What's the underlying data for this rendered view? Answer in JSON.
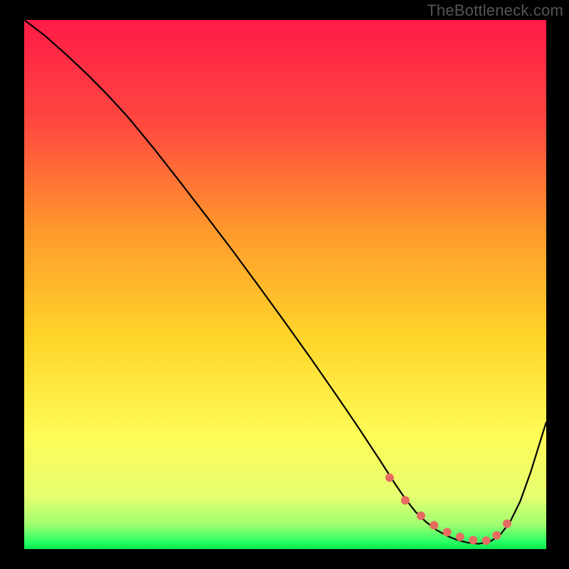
{
  "watermark": "TheBottleneck.com",
  "chart_data": {
    "type": "line",
    "title": "",
    "xlabel": "",
    "ylabel": "",
    "xlim": [
      0,
      100
    ],
    "ylim": [
      0,
      100
    ],
    "grid": false,
    "legend": false,
    "gradient_stops": [
      {
        "offset": 0.0,
        "color": "#ff1b48"
      },
      {
        "offset": 0.2,
        "color": "#ff4a3f"
      },
      {
        "offset": 0.4,
        "color": "#ff9a2c"
      },
      {
        "offset": 0.6,
        "color": "#ffd52a"
      },
      {
        "offset": 0.78,
        "color": "#fffb56"
      },
      {
        "offset": 0.9,
        "color": "#e6ff70"
      },
      {
        "offset": 0.955,
        "color": "#9dff70"
      },
      {
        "offset": 0.985,
        "color": "#2eff66"
      },
      {
        "offset": 1.0,
        "color": "#05e84f"
      }
    ],
    "series": [
      {
        "name": "bottleneck-curve",
        "color": "#000000",
        "x": [
          0,
          4,
          8,
          12,
          16,
          20,
          25,
          30,
          35,
          40,
          45,
          50,
          55,
          60,
          64,
          68,
          71,
          73,
          75,
          77,
          79,
          81,
          83,
          85,
          87,
          89,
          91,
          93,
          95,
          97,
          100
        ],
        "y": [
          100,
          97,
          93.5,
          89.8,
          85.8,
          81.5,
          75.5,
          69.2,
          62.8,
          56.3,
          49.6,
          42.8,
          35.9,
          28.8,
          23,
          17,
          12.4,
          9.5,
          7,
          5.1,
          3.6,
          2.5,
          1.7,
          1.2,
          1.0,
          1.3,
          2.5,
          5.0,
          9.0,
          14.5,
          24
        ]
      }
    ],
    "markers": {
      "name": "optimal-range-dots",
      "color": "#e76b61",
      "radius_px": 6,
      "x": [
        70,
        73,
        76,
        78.5,
        81,
        83.5,
        86,
        88.5,
        90.5,
        92.5
      ],
      "y": [
        13.5,
        9.2,
        6.3,
        4.5,
        3.2,
        2.3,
        1.7,
        1.6,
        2.6,
        4.8
      ]
    }
  }
}
